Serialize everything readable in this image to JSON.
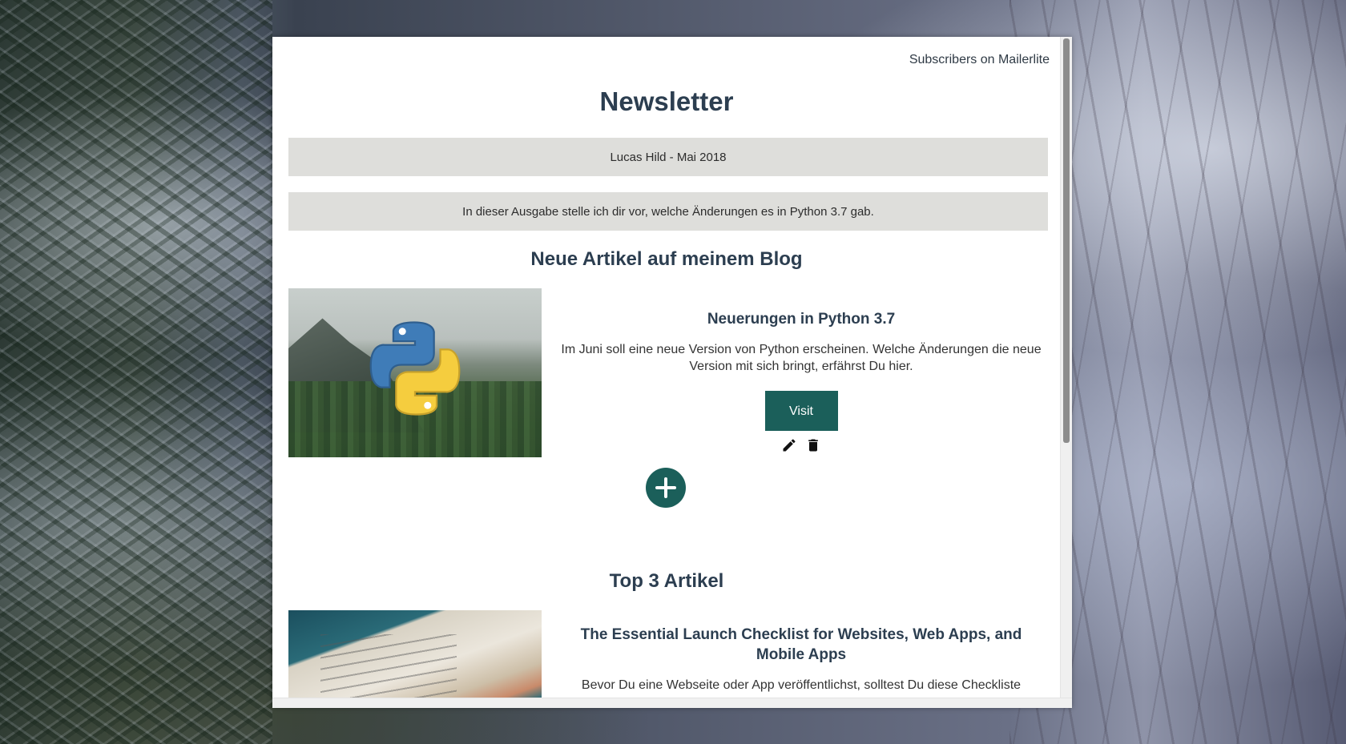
{
  "header": {
    "subscribers_link": "Subscribers on Mailerlite"
  },
  "newsletter": {
    "title": "Newsletter",
    "author_line": "Lucas Hild - Mai 2018",
    "intro": "In dieser Ausgabe stelle ich dir vor, welche Änderungen es in Python 3.7 gab."
  },
  "sections": [
    {
      "title": "Neue Artikel auf meinem Blog",
      "articles": [
        {
          "title": "Neuerungen in Python 3.7",
          "description": "Im Juni soll eine neue Version von Python erscheinen. Welche Änderungen die neue Version mit sich bringt, erfährst Du hier.",
          "button_label": "Visit",
          "image_icon": "python-logo"
        }
      ]
    },
    {
      "title": "Top 3 Artikel",
      "articles": [
        {
          "title": "The Essential Launch Checklist for Websites, Web Apps, and Mobile Apps",
          "description": "Bevor Du eine Webseite oder App veröffentlichst, solltest Du diese Checkliste",
          "image_icon": "notebook-photo"
        }
      ]
    }
  ],
  "icons": {
    "edit": "pencil-icon",
    "delete": "trash-icon",
    "add": "plus-circle-icon"
  },
  "colors": {
    "accent": "#1b5f5a",
    "band": "#dededb",
    "heading": "#2c3e50"
  }
}
